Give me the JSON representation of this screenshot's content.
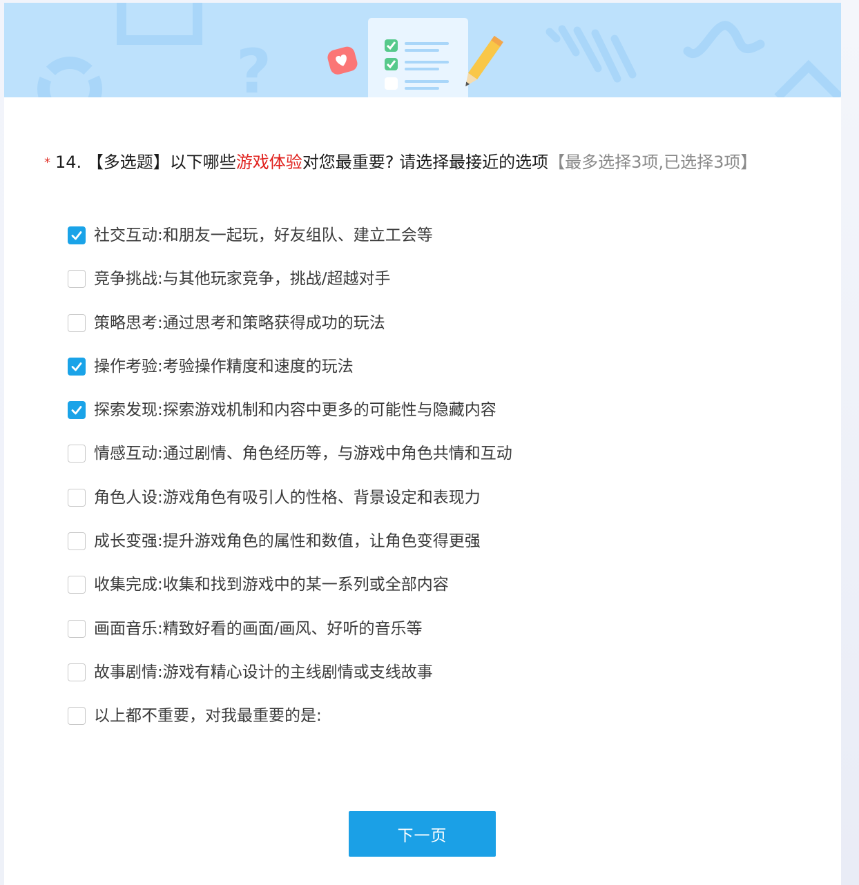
{
  "theme": {
    "banner_bg": "#bde1fc",
    "accent": "#1ba0e6",
    "required_color": "#e0342b",
    "highlight_color": "#e0201c"
  },
  "banner": {
    "icons": [
      "clipboard-checklist-icon",
      "pencil-icon",
      "heart-bubble-icon",
      "question-mark-icon"
    ]
  },
  "question": {
    "required_mark": "*",
    "number": "14.",
    "type_tag": "【多选题】",
    "text_before": "以下哪些",
    "text_highlight": "游戏体验",
    "text_after": "对您最重要? 请选择最接近的选项",
    "hint": "【最多选择3项,已选择3项】"
  },
  "options": [
    {
      "label": "社交互动:和朋友一起玩，好友组队、建立工会等",
      "checked": true
    },
    {
      "label": "竞争挑战:与其他玩家竞争，挑战/超越对手",
      "checked": false
    },
    {
      "label": "策略思考:通过思考和策略获得成功的玩法",
      "checked": false
    },
    {
      "label": "操作考验:考验操作精度和速度的玩法",
      "checked": true
    },
    {
      "label": "探索发现:探索游戏机制和内容中更多的可能性与隐藏内容",
      "checked": true
    },
    {
      "label": "情感互动:通过剧情、角色经历等，与游戏中角色共情和互动",
      "checked": false
    },
    {
      "label": "角色人设:游戏角色有吸引人的性格、背景设定和表现力",
      "checked": false
    },
    {
      "label": "成长变强:提升游戏角色的属性和数值，让角色变得更强",
      "checked": false
    },
    {
      "label": "收集完成:收集和找到游戏中的某一系列或全部内容",
      "checked": false
    },
    {
      "label": "画面音乐:精致好看的画面/画风、好听的音乐等",
      "checked": false
    },
    {
      "label": "故事剧情:游戏有精心设计的主线剧情或支线故事",
      "checked": false
    },
    {
      "label": "以上都不重要，对我最重要的是:",
      "checked": false
    }
  ],
  "footer": {
    "next_label": "下一页"
  }
}
